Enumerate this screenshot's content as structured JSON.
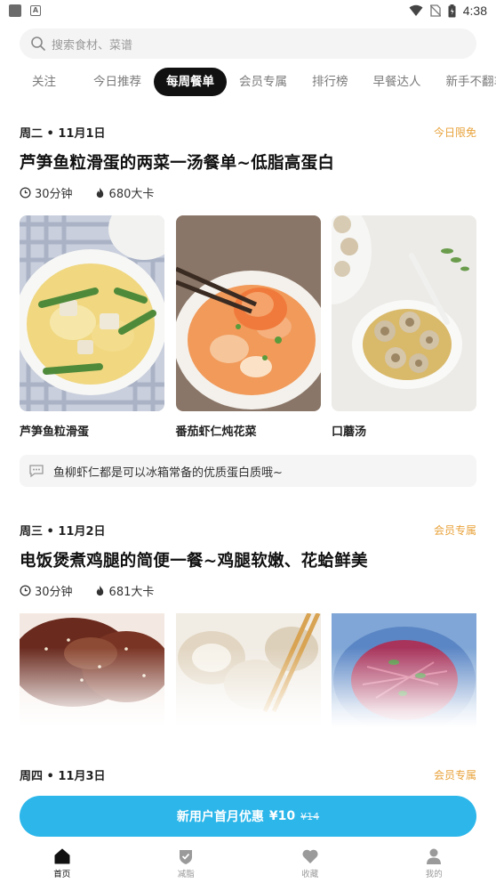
{
  "status_bar": {
    "time": "4:38"
  },
  "search": {
    "placeholder": "搜索食材、菜谱"
  },
  "tabs": [
    {
      "label": "关注"
    },
    {
      "label": "今日推荐"
    },
    {
      "label": "每周餐单"
    },
    {
      "label": "会员专属"
    },
    {
      "label": "排行榜"
    },
    {
      "label": "早餐达人"
    },
    {
      "label": "新手不翻车"
    }
  ],
  "sections": [
    {
      "date": "周二 • 11月1日",
      "badge": "今日限免",
      "title": "芦笋鱼粒滑蛋的两菜一汤餐单~低脂高蛋白",
      "time": "30分钟",
      "calories": "680大卡",
      "dishes": [
        "芦笋鱼粒滑蛋",
        "番茄虾仁炖花菜",
        "口蘑汤"
      ],
      "tip": "鱼柳虾仁都是可以冰箱常备的优质蛋白质哦~"
    },
    {
      "date": "周三 • 11月2日",
      "badge": "会员专属",
      "title": "电饭煲煮鸡腿的简便一餐~鸡腿软嫩、花蛤鲜美",
      "time": "30分钟",
      "calories": "681大卡"
    },
    {
      "date": "周四 • 11月3日",
      "badge": "会员专属"
    }
  ],
  "promo": {
    "label": "新用户首月优惠",
    "price": "¥10",
    "old_price": "¥14"
  },
  "nav": [
    {
      "label": "首页",
      "icon": "home-icon"
    },
    {
      "label": "减脂",
      "icon": "shield-check-icon"
    },
    {
      "label": "收藏",
      "icon": "heart-icon"
    },
    {
      "label": "我的",
      "icon": "person-icon"
    }
  ],
  "colors": {
    "accent": "#2cb6ea",
    "badge": "#e8a23a",
    "active_tab": "#111111"
  }
}
